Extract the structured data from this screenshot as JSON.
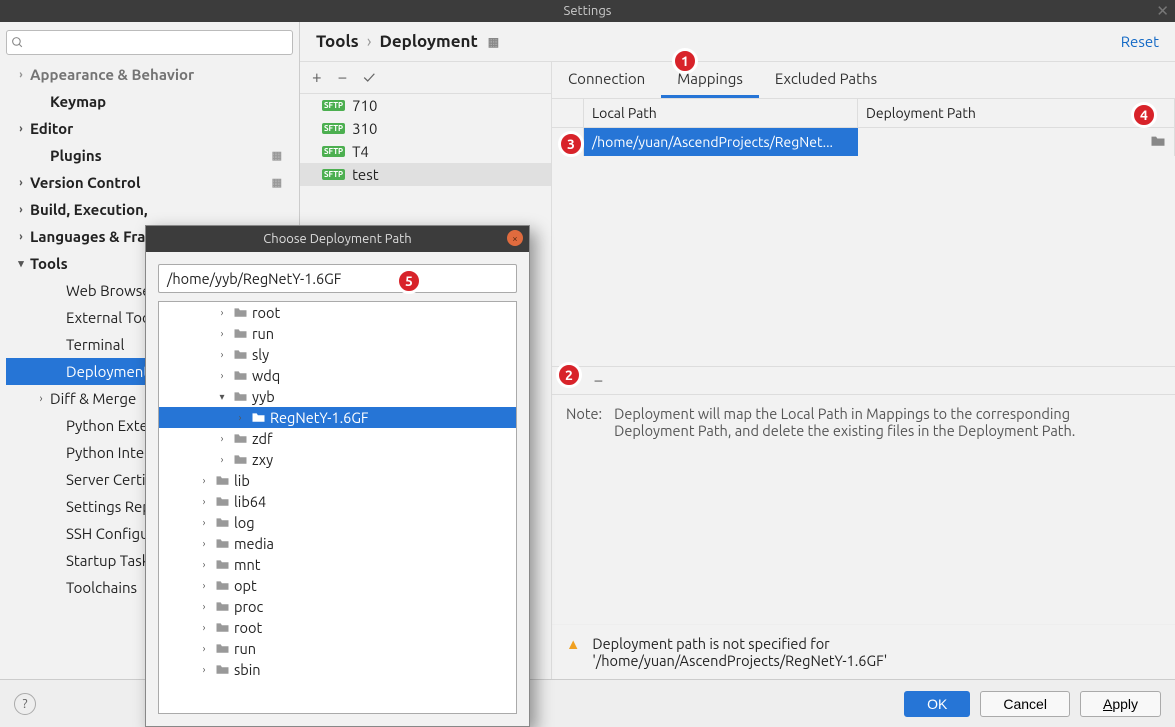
{
  "window": {
    "title": "Settings"
  },
  "sidebar": {
    "items": [
      {
        "label": "Appearance & Behavior",
        "chevron": ">",
        "bold": true,
        "dim": true
      },
      {
        "label": "Keymap",
        "bold": true,
        "indent": 1
      },
      {
        "label": "Editor",
        "chevron": ">",
        "bold": true
      },
      {
        "label": "Plugins",
        "bold": true,
        "indent": 1,
        "dots": true
      },
      {
        "label": "Version Control",
        "chevron": ">",
        "bold": true,
        "dots": true
      },
      {
        "label": "Build, Execution, Deployment",
        "chevron": ">",
        "bold": true,
        "truncated": "Build, Execution,"
      },
      {
        "label": "Languages & Frameworks",
        "chevron": ">",
        "bold": true,
        "truncated": "Languages & Fra"
      },
      {
        "label": "Tools",
        "chevron": "v",
        "bold": true
      },
      {
        "label": "Web Browsers",
        "indent": 2,
        "truncated": "Web Browsers"
      },
      {
        "label": "External Tools",
        "indent": 2
      },
      {
        "label": "Terminal",
        "indent": 2
      },
      {
        "label": "Deployment",
        "indent": 2,
        "selected": true
      },
      {
        "label": "Diff & Merge",
        "chevron": ">",
        "indent": 1
      },
      {
        "label": "Python External",
        "indent": 2,
        "truncated": "Python Externa"
      },
      {
        "label": "Python Integrated Tools",
        "indent": 2,
        "truncated": "Python Integra"
      },
      {
        "label": "Server Certificates",
        "indent": 2,
        "truncated": "Server Certifica"
      },
      {
        "label": "Settings Repository",
        "indent": 2,
        "truncated": "Settings Repos"
      },
      {
        "label": "SSH Configurations",
        "indent": 2,
        "truncated": "SSH Configura"
      },
      {
        "label": "Startup Tasks",
        "indent": 2
      },
      {
        "label": "Toolchains",
        "indent": 2
      }
    ]
  },
  "breadcrumb": {
    "part1": "Tools",
    "part2": "Deployment",
    "reset": "Reset"
  },
  "servers": [
    {
      "name": "710"
    },
    {
      "name": "310"
    },
    {
      "name": "T4"
    },
    {
      "name": "test",
      "active": true
    }
  ],
  "tabs": {
    "connection": "Connection",
    "mappings": "Mappings",
    "excluded": "Excluded Paths"
  },
  "table": {
    "local_header": "Local Path",
    "deploy_header": "Deployment Path",
    "row_local": "/home/yuan/AscendProjects/RegNet..."
  },
  "note": {
    "label": "Note:",
    "text": "Deployment will map the Local Path in Mappings to the corresponding Deployment Path, and delete the existing files in the Deployment Path."
  },
  "warn": {
    "line1": "Deployment path is not specified for",
    "line2": "'/home/yuan/AscendProjects/RegNetY-1.6GF'"
  },
  "buttons": {
    "ok": "OK",
    "cancel": "Cancel",
    "apply": "Apply"
  },
  "dialog": {
    "title": "Choose Deployment Path",
    "path": "/home/yyb/RegNetY-1.6GF",
    "tree": [
      {
        "name": "root",
        "depth": 2,
        "chev": ">"
      },
      {
        "name": "run",
        "depth": 2,
        "chev": ">"
      },
      {
        "name": "sly",
        "depth": 2,
        "chev": ">"
      },
      {
        "name": "wdq",
        "depth": 2,
        "chev": ">"
      },
      {
        "name": "yyb",
        "depth": 2,
        "chev": "v"
      },
      {
        "name": "RegNetY-1.6GF",
        "depth": 3,
        "chev": ">",
        "sel": true
      },
      {
        "name": "zdf",
        "depth": 2,
        "chev": ">"
      },
      {
        "name": "zxy",
        "depth": 2,
        "chev": ">"
      },
      {
        "name": "lib",
        "depth": 1,
        "chev": ">"
      },
      {
        "name": "lib64",
        "depth": 1,
        "chev": ">"
      },
      {
        "name": "log",
        "depth": 1,
        "chev": ">"
      },
      {
        "name": "media",
        "depth": 1,
        "chev": ">"
      },
      {
        "name": "mnt",
        "depth": 1,
        "chev": ">"
      },
      {
        "name": "opt",
        "depth": 1,
        "chev": ">"
      },
      {
        "name": "proc",
        "depth": 1,
        "chev": ">"
      },
      {
        "name": "root",
        "depth": 1,
        "chev": ">"
      },
      {
        "name": "run",
        "depth": 1,
        "chev": ">"
      },
      {
        "name": "sbin",
        "depth": 1,
        "chev": ">"
      }
    ]
  },
  "badges": {
    "b1": "1",
    "b2": "2",
    "b3": "3",
    "b4": "4",
    "b5": "5"
  }
}
